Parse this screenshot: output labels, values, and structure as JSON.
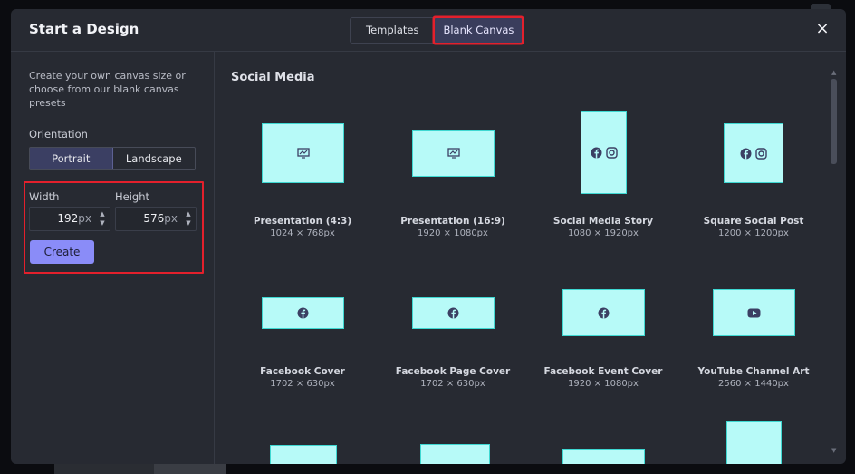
{
  "modal": {
    "title": "Start a Design",
    "tabs": [
      {
        "label": "Templates",
        "active": false
      },
      {
        "label": "Blank Canvas",
        "active": true
      }
    ],
    "close_icon": "×"
  },
  "sidebar": {
    "intro": "Create your own canvas size or choose from our blank canvas presets",
    "orientation_label": "Orientation",
    "orientation_options": [
      "Portrait",
      "Landscape"
    ],
    "selected_orientation": "Portrait",
    "width_label": "Width",
    "height_label": "Height",
    "width_value": "192",
    "height_value": "576",
    "unit": "px",
    "create_label": "Create"
  },
  "main": {
    "section_title": "Social Media",
    "presets": [
      {
        "label": "Presentation (4:3)",
        "size": "1024 × 768px",
        "icon": "presentation-icon"
      },
      {
        "label": "Presentation (16:9)",
        "size": "1920 × 1080px",
        "icon": "presentation-icon"
      },
      {
        "label": "Social Media Story",
        "size": "1080 × 1920px",
        "icon": "facebook-instagram-icons"
      },
      {
        "label": "Square Social Post",
        "size": "1200 × 1200px",
        "icon": "facebook-instagram-icons"
      },
      {
        "label": "Facebook Cover",
        "size": "1702 × 630px",
        "icon": "facebook-icon"
      },
      {
        "label": "Facebook Page Cover",
        "size": "1702 × 630px",
        "icon": "facebook-icon"
      },
      {
        "label": "Facebook Event Cover",
        "size": "1920 × 1080px",
        "icon": "facebook-icon"
      },
      {
        "label": "YouTube Channel Art",
        "size": "2560 × 1440px",
        "icon": "youtube-icon"
      }
    ]
  },
  "colors": {
    "accent": "#8a8cf8",
    "thumb_fill": "#b7faf8",
    "thumb_border": "#3ed8d2",
    "highlight": "#e3202c",
    "modal_bg": "#272a32"
  }
}
